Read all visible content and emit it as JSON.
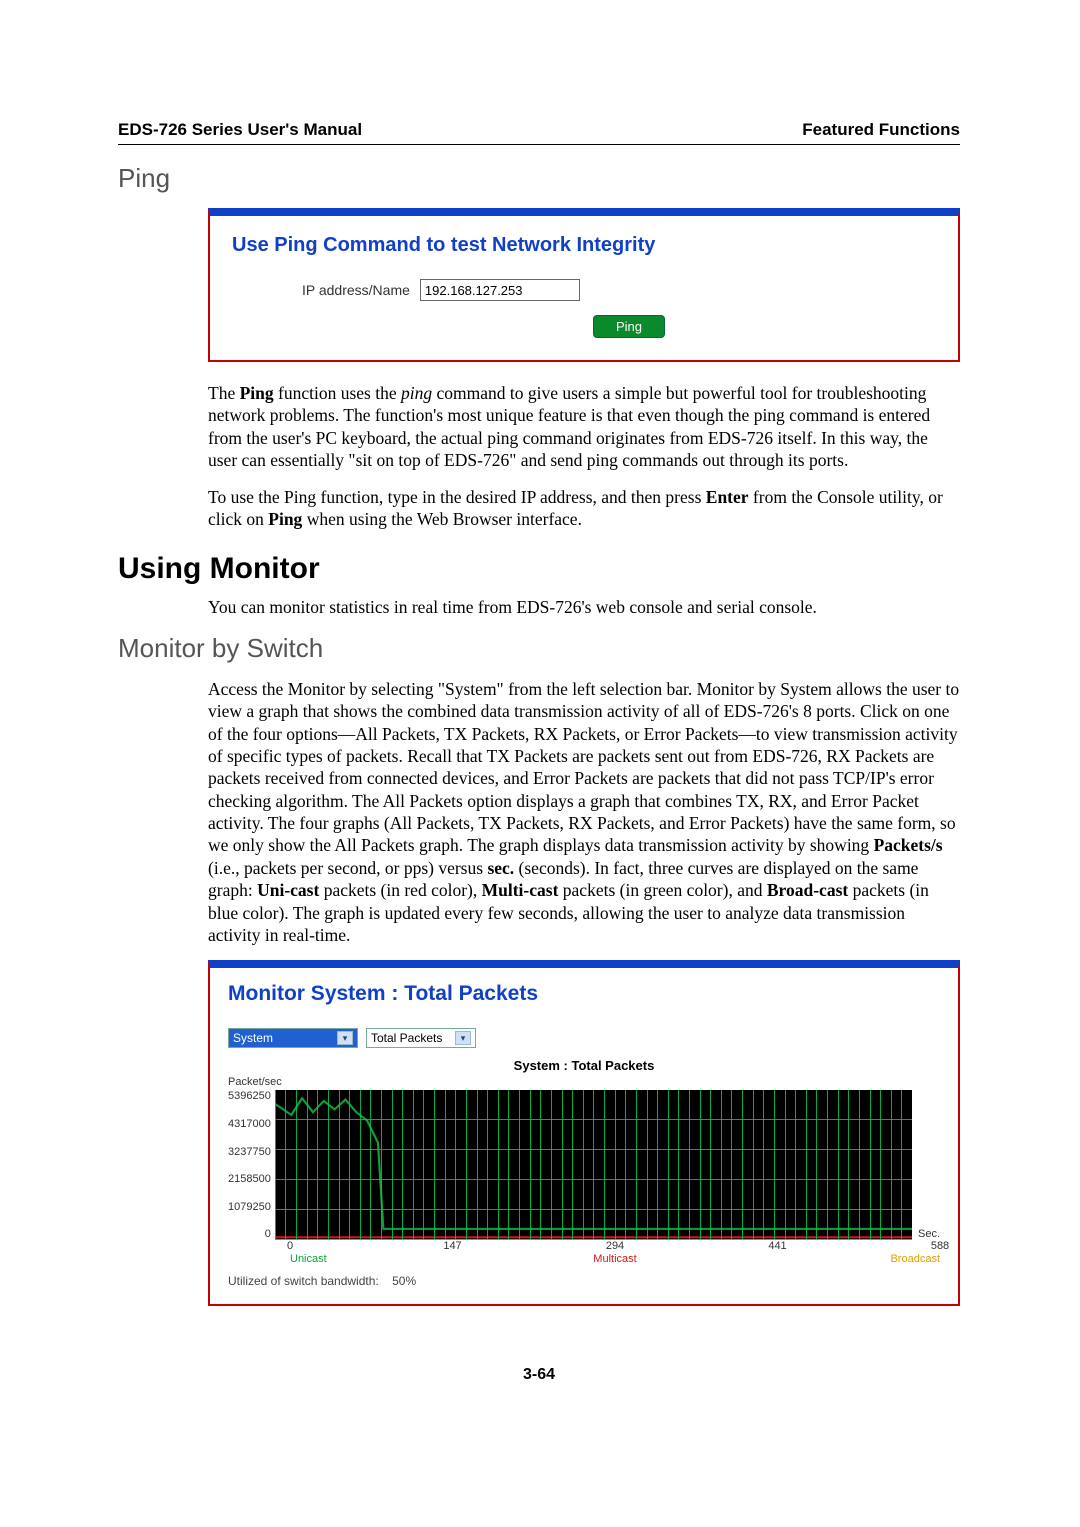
{
  "header": {
    "left": "EDS-726 Series User's Manual",
    "right": "Featured Functions"
  },
  "sec_ping": {
    "heading": "Ping",
    "panel_title": "Use Ping Command to test Network Integrity",
    "ip_label": "IP address/Name",
    "ip_value": "192.168.127.253",
    "button": "Ping",
    "p1_a": "The ",
    "p1_b": "Ping",
    "p1_c": " function uses the ",
    "p1_d": "ping",
    "p1_e": " command to give users a simple but powerful tool for troubleshooting network problems. The function's most unique feature is that even though the ping command is entered from the user's PC keyboard, the actual ping command originates from EDS-726 itself. In this way, the user can essentially \"sit on top of EDS-726\" and send ping commands out through its ports.",
    "p2_a": "To use the Ping function, type in the desired IP address, and then press ",
    "p2_b": "Enter",
    "p2_c": " from the Console utility, or click on ",
    "p2_d": "Ping",
    "p2_e": " when using the Web Browser interface."
  },
  "sec_monitor": {
    "heading": "Using Monitor",
    "p1": "You can monitor statistics in real time from EDS-726's web console and serial console.",
    "sub": "Monitor by Switch",
    "p2_a": "Access the Monitor by selecting \"System\" from the left selection bar. Monitor by System allows the user to view a graph that shows the combined data transmission activity of all of EDS-726's 8 ports. Click on one of the four options—All Packets, TX Packets, RX Packets, or Error Packets—to view transmission activity of specific types of packets. Recall that TX Packets are packets sent out from EDS-726, RX Packets are packets received from connected devices, and Error Packets are packets that did not pass TCP/IP's error checking algorithm. The All Packets option displays a graph that combines TX, RX, and Error Packet activity. The four graphs (All Packets, TX Packets, RX Packets, and Error Packets) have the same form, so we only show the All Packets graph. The graph displays data transmission activity by showing ",
    "p2_b": "Packets/s",
    "p2_c": " (i.e., packets per second, or pps) versus ",
    "p2_d": "sec.",
    "p2_e": " (seconds). In fact, three curves are displayed on the same graph: ",
    "p2_f": "Uni-cast",
    "p2_g": " packets (in red color), ",
    "p2_h": "Multi-cast",
    "p2_i": " packets (in green color), and ",
    "p2_j": "Broad-cast",
    "p2_k": " packets (in blue color). The graph is updated every few seconds, allowing the user to analyze data transmission activity in real-time."
  },
  "mon_panel": {
    "title": "Monitor System : Total Packets",
    "sel1": "System",
    "sel2": "Total Packets",
    "chart_inner_title": "System : Total Packets",
    "ylabel": "Packet/sec",
    "sec_label": "Sec.",
    "util_label": "Utilized of switch bandwidth:",
    "util_val": "50%",
    "legend": {
      "uni": "Unicast",
      "multi": "Multicast",
      "broad": "Broadcast"
    }
  },
  "chart_data": {
    "type": "line",
    "xlabel": "Sec.",
    "ylabel": "Packet/sec",
    "title": "System : Total Packets",
    "x_ticks": [
      0,
      147,
      294,
      441,
      588
    ],
    "y_ticks": [
      0,
      1079250,
      2158500,
      3237750,
      4317000,
      5396250
    ],
    "xlim": [
      0,
      588
    ],
    "ylim": [
      0,
      5396250
    ],
    "series": [
      {
        "name": "Unicast",
        "color": "#0aa33a",
        "values": [
          [
            0,
            4900000
          ],
          [
            15,
            4500000
          ],
          [
            25,
            5100000
          ],
          [
            35,
            4600000
          ],
          [
            45,
            5000000
          ],
          [
            55,
            4700000
          ],
          [
            65,
            5050000
          ],
          [
            75,
            4600000
          ],
          [
            85,
            4300000
          ],
          [
            95,
            3500000
          ],
          [
            100,
            400000
          ],
          [
            588,
            400000
          ]
        ]
      },
      {
        "name": "Multicast",
        "color": "#d01818",
        "values": [
          [
            0,
            100000
          ],
          [
            588,
            100000
          ]
        ]
      },
      {
        "name": "Broadcast",
        "color": "#e0a000",
        "values": [
          [
            0,
            0
          ],
          [
            588,
            0
          ]
        ]
      }
    ]
  },
  "page_num": "3-64"
}
